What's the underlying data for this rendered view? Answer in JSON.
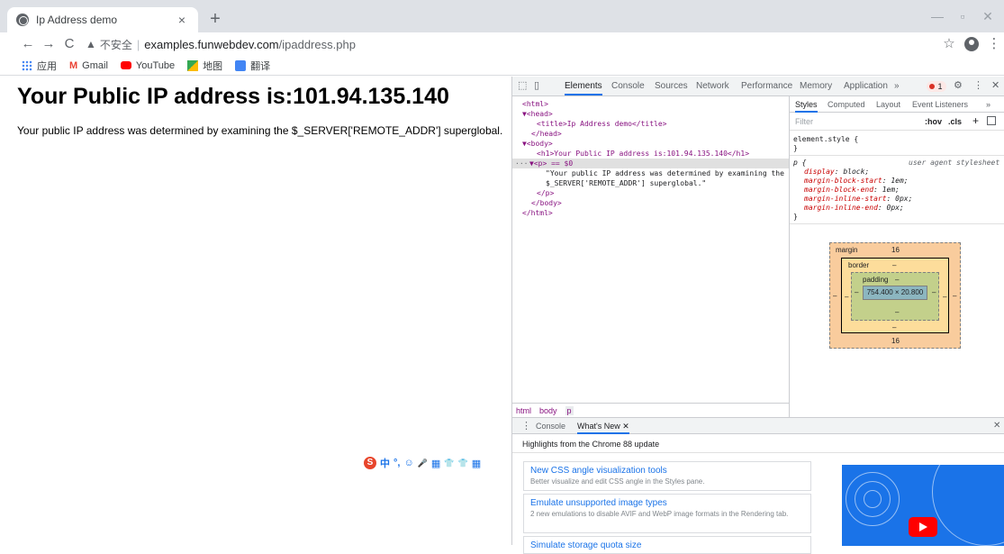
{
  "browser": {
    "tab_title": "Ip Address demo",
    "close_tab": "×",
    "new_tab": "+",
    "url_insecure_label": "不安全",
    "url_host": "examples.funwebdev.com",
    "url_path": "/ipaddress.php",
    "bookmarks": [
      "应用",
      "Gmail",
      "YouTube",
      "地图",
      "翻译"
    ]
  },
  "page": {
    "heading": "Your Public IP address is:101.94.135.140",
    "paragraph": "Your public IP address was determined by examining the $_SERVER['REMOTE_ADDR'] superglobal."
  },
  "devtools": {
    "tabs": [
      "Elements",
      "Console",
      "Sources",
      "Network",
      "Performance",
      "Memory",
      "Application",
      "»"
    ],
    "error_count": "1",
    "dom": [
      "<html>",
      "▼<head>",
      "<title>Ip Address demo</title>",
      "</head>",
      "▼<body>",
      "<h1>Your Public IP address is:101.94.135.140</h1>",
      "▼<p> == $0",
      "\"Your public IP address was determined by examining the",
      "$_SERVER['REMOTE_ADDR'] superglobal.\"",
      "</p>",
      "</body>",
      "</html>"
    ],
    "breadcrumbs": [
      "html",
      "body",
      "p"
    ],
    "styles_tabs": [
      "Styles",
      "Computed",
      "Layout",
      "Event Listeners",
      "»"
    ],
    "filter_placeholder": "Filter",
    "hov": ":hov",
    "cls": ".cls",
    "element_style_open": "element.style {",
    "close_brace": "}",
    "rule_selector": "p {",
    "rule_source": "user agent stylesheet",
    "rule_props": [
      {
        "prop": "display",
        "val": "block;"
      },
      {
        "prop": "margin-block-start",
        "val": "1em;"
      },
      {
        "prop": "margin-block-end",
        "val": "1em;"
      },
      {
        "prop": "margin-inline-start",
        "val": "0px;"
      },
      {
        "prop": "margin-inline-end",
        "val": "0px;"
      }
    ],
    "box_model": {
      "margin_label": "margin",
      "margin_top": "16",
      "margin_bottom": "16",
      "border_label": "border",
      "padding_label": "padding",
      "dash": "–",
      "content": "754.400 × 20.800"
    },
    "drawer": {
      "tabs": [
        "Console",
        "What's New"
      ],
      "highlights": "Highlights from the Chrome 88 update",
      "features": [
        {
          "title": "New CSS angle visualization tools",
          "desc": "Better visualize and edit CSS angle in the Styles pane."
        },
        {
          "title": "Emulate unsupported image types",
          "desc": "2 new emulations to disable AVIF and WebP image formats in the Rendering tab."
        },
        {
          "title": "Simulate storage quota size",
          "desc": ""
        }
      ]
    }
  },
  "ime_bar": [
    "S",
    "中",
    "°,",
    "☺",
    "🎤",
    "▦",
    "👕",
    "👕",
    "▦"
  ]
}
